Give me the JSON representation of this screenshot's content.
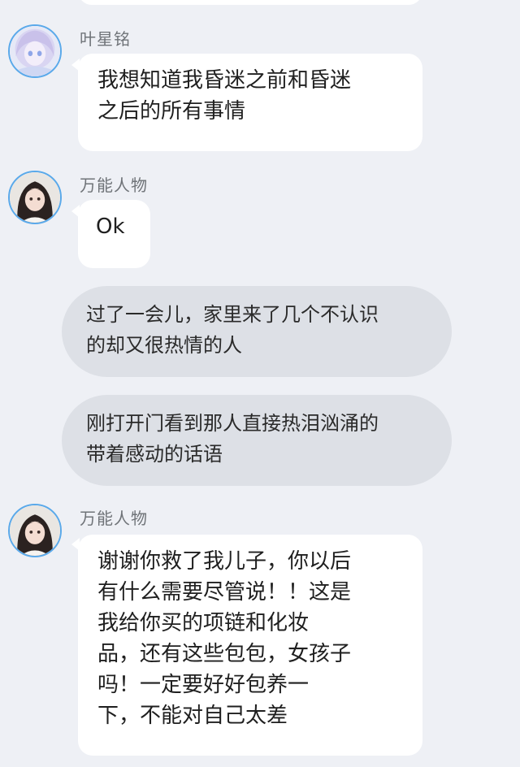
{
  "messages": [
    {
      "sender": "叶星铭",
      "avatar_icon": "anime-girl-avatar-icon",
      "text": "我想知道我昏迷之前和昏迷\n之后的所有事情"
    },
    {
      "sender": "万能人物",
      "avatar_icon": "girl-photo-avatar-icon",
      "text": "Ok"
    }
  ],
  "narrations": [
    "过了一会儿，家里来了几个不认识\n的却又很热情的人",
    "刚打开门看到那人直接热泪汹涌的\n带着感动的话语"
  ],
  "final_message": {
    "sender": "万能人物",
    "avatar_icon": "girl-photo-avatar-icon",
    "text": "谢谢你救了我儿子，你以后\n有什么需要尽管说！！这是\n我给你买的项链和化妆\n品，还有这些包包，女孩子\n吗！一定要好好包养一\n下，不能对自己太差"
  },
  "colors": {
    "background": "#eef0f5",
    "bubble": "#ffffff",
    "narration": "#dde0e6",
    "avatar_ring": "#5aa9ea"
  }
}
